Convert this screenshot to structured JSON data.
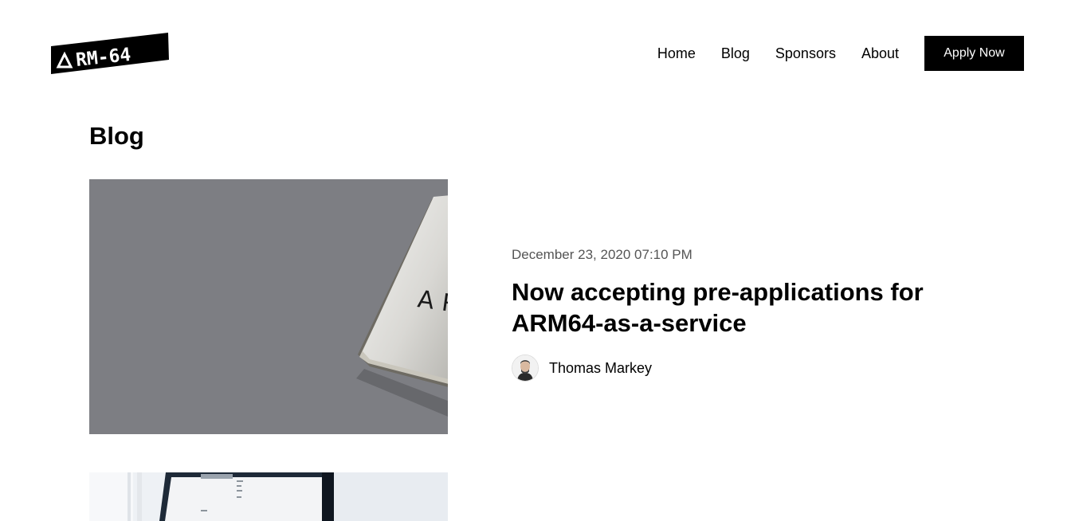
{
  "header": {
    "logo_text": "ARM-64",
    "nav": [
      {
        "label": "Home"
      },
      {
        "label": "Blog"
      },
      {
        "label": "Sponsors"
      },
      {
        "label": "About"
      }
    ],
    "cta_label": "Apply Now"
  },
  "page": {
    "title": "Blog"
  },
  "posts": [
    {
      "date": "December 23, 2020 07:10 PM",
      "title": "Now accepting pre-applications for ARM64-as-a-service",
      "author": "Thomas Markey",
      "image_icon": "arm-chip-image",
      "chip_text": "AR"
    },
    {
      "image_icon": "monitor-image"
    }
  ],
  "colors": {
    "background": "#ffffff",
    "text": "#000000",
    "button_bg": "#000000",
    "button_text": "#ffffff",
    "date_text": "#555555",
    "image_gray": "#7d7e83"
  }
}
